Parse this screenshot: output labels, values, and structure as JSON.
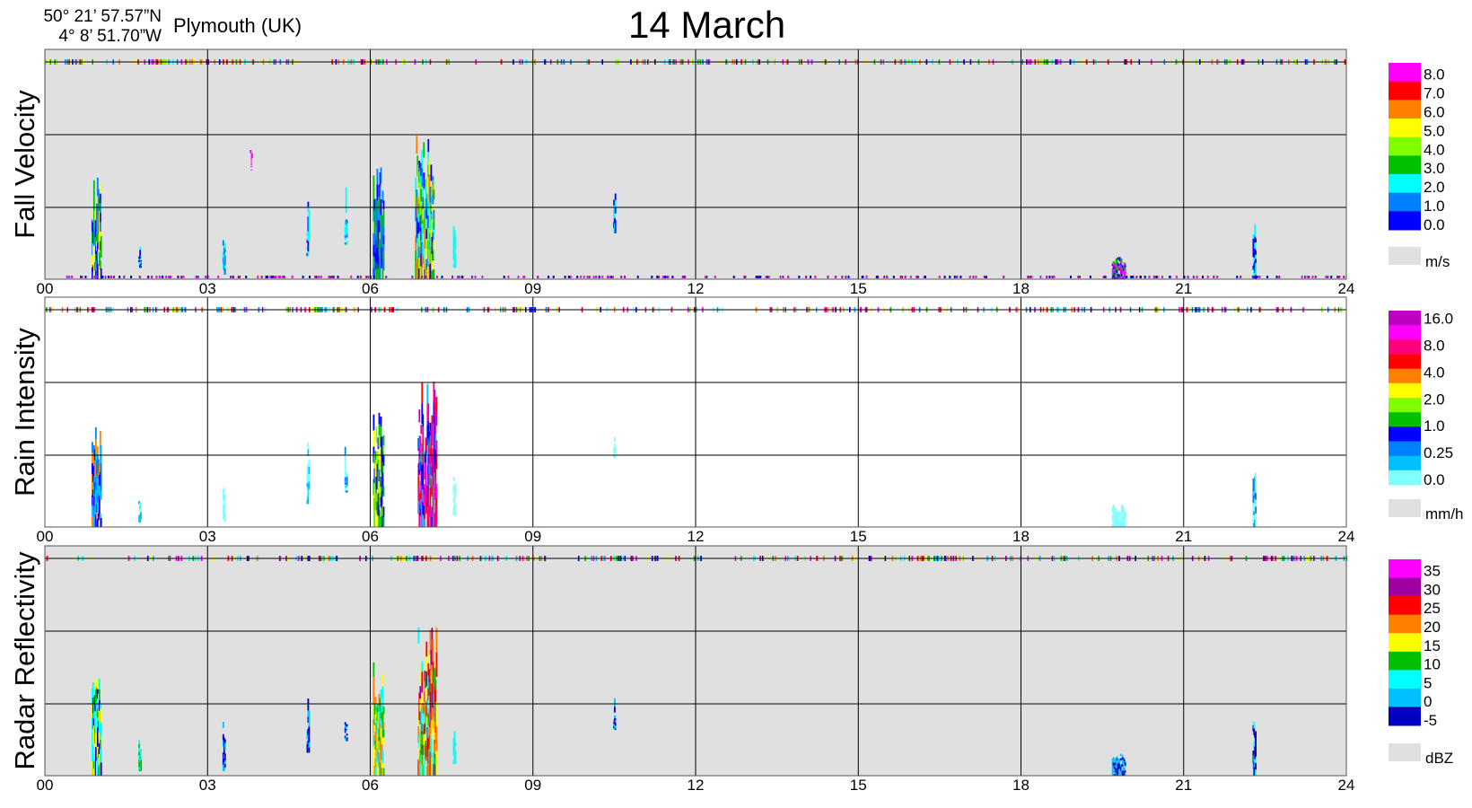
{
  "header": {
    "lat": "50° 21’ 57.57”N",
    "lon": "4°  8’ 51.70”W",
    "location": "Plymouth (UK)",
    "title": "14 March"
  },
  "colors": {
    "panel_bg": "#e0e0e0",
    "grid": "#000000"
  },
  "chart_data": [
    {
      "type": "heatmap",
      "ylabel": "Fall Velocity",
      "xlim": [
        0,
        24
      ],
      "x_ticks": [
        "00",
        "03",
        "06",
        "09",
        "12",
        "15",
        "18",
        "21",
        "24"
      ],
      "background": "#e0e0e0",
      "colorbar": {
        "unit": "m/s",
        "labels": [
          "8.0",
          "7.0",
          "6.0",
          "5.0",
          "4.0",
          "3.0",
          "2.0",
          "1.0",
          "0.0"
        ],
        "colors": [
          "#ff00ff",
          "#ff0000",
          "#ff8000",
          "#ffff00",
          "#80ff00",
          "#00c000",
          "#00ffff",
          "#0080ff",
          "#0000ff"
        ]
      },
      "events": [
        {
          "t": 0.95,
          "w": 0.18,
          "bottom": 0.0,
          "top": 0.45,
          "colors": [
            "#0000ff",
            "#0080ff",
            "#00c000",
            "#ffff00"
          ]
        },
        {
          "t": 1.75,
          "w": 0.05,
          "bottom": 0.05,
          "top": 0.16,
          "colors": [
            "#0000ff",
            "#00ffff"
          ]
        },
        {
          "t": 3.3,
          "w": 0.05,
          "bottom": 0.02,
          "top": 0.25,
          "colors": [
            "#0080ff",
            "#00ffff"
          ]
        },
        {
          "t": 3.8,
          "w": 0.04,
          "bottom": 0.55,
          "top": 0.6,
          "colors": [
            "#ff00ff"
          ]
        },
        {
          "t": 4.85,
          "w": 0.05,
          "bottom": 0.1,
          "top": 0.37,
          "colors": [
            "#0000ff",
            "#00ffff"
          ]
        },
        {
          "t": 5.55,
          "w": 0.05,
          "bottom": 0.15,
          "top": 0.4,
          "colors": [
            "#0080ff",
            "#00ffff"
          ]
        },
        {
          "t": 6.15,
          "w": 0.2,
          "bottom": 0.0,
          "top": 0.5,
          "colors": [
            "#0000ff",
            "#0080ff",
            "#00c000"
          ]
        },
        {
          "t": 7.0,
          "w": 0.35,
          "bottom": 0.0,
          "top": 0.65,
          "colors": [
            "#0000ff",
            "#0080ff",
            "#00ffff",
            "#00c000",
            "#80ff00",
            "#ffff00",
            "#ff8000"
          ]
        },
        {
          "t": 7.55,
          "w": 0.05,
          "bottom": 0.05,
          "top": 0.25,
          "colors": [
            "#00ffff"
          ]
        },
        {
          "t": 10.5,
          "w": 0.04,
          "bottom": 0.2,
          "top": 0.4,
          "colors": [
            "#0000ff",
            "#00ffff"
          ]
        },
        {
          "t": 19.8,
          "w": 0.25,
          "bottom": 0.0,
          "top": 0.1,
          "colors": [
            "#0000ff",
            "#00c000",
            "#ff00ff"
          ]
        },
        {
          "t": 22.3,
          "w": 0.06,
          "bottom": 0.0,
          "top": 0.28,
          "colors": [
            "#0000ff",
            "#00ffff"
          ]
        }
      ]
    },
    {
      "type": "heatmap",
      "ylabel": "Rain Intensity",
      "xlim": [
        0,
        24
      ],
      "x_ticks": [
        "00",
        "03",
        "06",
        "09",
        "12",
        "15",
        "18",
        "21",
        "24"
      ],
      "background": "#ffffff",
      "colorbar": {
        "unit": "mm/h",
        "labels": [
          "16.0",
          "8.0",
          "4.0",
          "2.0",
          "1.0",
          "0.25",
          "0.0"
        ],
        "colors": [
          "#c000c0",
          "#ff00ff",
          "#ff0080",
          "#ff0000",
          "#ff8000",
          "#ffff00",
          "#80ff00",
          "#00c000",
          "#0000ff",
          "#0080ff",
          "#00c0ff",
          "#80ffff"
        ]
      },
      "events": [
        {
          "t": 0.95,
          "w": 0.18,
          "bottom": 0.0,
          "top": 0.45,
          "colors": [
            "#0000ff",
            "#0080ff",
            "#00c0ff",
            "#ff8000"
          ]
        },
        {
          "t": 1.75,
          "w": 0.05,
          "bottom": 0.02,
          "top": 0.16,
          "colors": [
            "#00c0ff",
            "#80ffff"
          ]
        },
        {
          "t": 3.3,
          "w": 0.05,
          "bottom": 0.02,
          "top": 0.25,
          "colors": [
            "#80ffff"
          ]
        },
        {
          "t": 4.85,
          "w": 0.05,
          "bottom": 0.1,
          "top": 0.37,
          "colors": [
            "#00c0ff",
            "#80ffff"
          ]
        },
        {
          "t": 5.55,
          "w": 0.05,
          "bottom": 0.15,
          "top": 0.4,
          "colors": [
            "#0080ff",
            "#80ffff"
          ]
        },
        {
          "t": 6.15,
          "w": 0.2,
          "bottom": 0.0,
          "top": 0.5,
          "colors": [
            "#0000ff",
            "#00c000",
            "#80ff00",
            "#ffff00"
          ]
        },
        {
          "t": 7.05,
          "w": 0.35,
          "bottom": 0.0,
          "top": 0.65,
          "colors": [
            "#ff0080",
            "#ff00ff",
            "#c000c0",
            "#ff0000",
            "#0000ff",
            "#00c0ff"
          ]
        },
        {
          "t": 7.55,
          "w": 0.05,
          "bottom": 0.05,
          "top": 0.25,
          "colors": [
            "#80ffff"
          ]
        },
        {
          "t": 10.5,
          "w": 0.04,
          "bottom": 0.3,
          "top": 0.4,
          "colors": [
            "#80ffff"
          ]
        },
        {
          "t": 19.8,
          "w": 0.25,
          "bottom": 0.0,
          "top": 0.1,
          "colors": [
            "#80ffff"
          ]
        },
        {
          "t": 22.3,
          "w": 0.06,
          "bottom": 0.0,
          "top": 0.28,
          "colors": [
            "#0080ff",
            "#80ffff"
          ]
        }
      ]
    },
    {
      "type": "heatmap",
      "ylabel": "Radar Reflectivity",
      "xlim": [
        0,
        24
      ],
      "x_ticks": [
        "00",
        "03",
        "06",
        "09",
        "12",
        "15",
        "18",
        "21",
        "24"
      ],
      "background": "#e0e0e0",
      "colorbar": {
        "unit": "dBZ",
        "labels": [
          "35",
          "30",
          "25",
          "20",
          "15",
          "10",
          "5",
          "0",
          "-5"
        ],
        "colors": [
          "#ff00ff",
          "#a000a0",
          "#ff0000",
          "#ff8000",
          "#ffff00",
          "#00c000",
          "#00ffff",
          "#00c0ff",
          "#0000c0"
        ]
      },
      "events": [
        {
          "t": 0.95,
          "w": 0.18,
          "bottom": 0.0,
          "top": 0.45,
          "colors": [
            "#00c000",
            "#ffff00",
            "#00ffff",
            "#0000c0"
          ]
        },
        {
          "t": 1.75,
          "w": 0.05,
          "bottom": 0.02,
          "top": 0.16,
          "colors": [
            "#00ffff",
            "#00c000"
          ]
        },
        {
          "t": 3.3,
          "w": 0.05,
          "bottom": 0.02,
          "top": 0.25,
          "colors": [
            "#00c0ff",
            "#0000c0"
          ]
        },
        {
          "t": 4.85,
          "w": 0.05,
          "bottom": 0.1,
          "top": 0.37,
          "colors": [
            "#0000c0",
            "#00c0ff"
          ]
        },
        {
          "t": 5.55,
          "w": 0.05,
          "bottom": 0.15,
          "top": 0.4,
          "colors": [
            "#0000c0",
            "#00ffff"
          ]
        },
        {
          "t": 6.15,
          "w": 0.2,
          "bottom": 0.0,
          "top": 0.5,
          "colors": [
            "#ffff00",
            "#00c000",
            "#ff8000",
            "#00ffff"
          ]
        },
        {
          "t": 7.05,
          "w": 0.35,
          "bottom": 0.0,
          "top": 0.65,
          "colors": [
            "#ff8000",
            "#ffff00",
            "#ff0000",
            "#00c000",
            "#00ffff",
            "#a000a0"
          ]
        },
        {
          "t": 7.55,
          "w": 0.05,
          "bottom": 0.05,
          "top": 0.25,
          "colors": [
            "#00ffff"
          ]
        },
        {
          "t": 10.5,
          "w": 0.04,
          "bottom": 0.2,
          "top": 0.4,
          "colors": [
            "#00c0ff",
            "#0000c0"
          ]
        },
        {
          "t": 19.8,
          "w": 0.25,
          "bottom": 0.0,
          "top": 0.1,
          "colors": [
            "#0000c0",
            "#00c0ff"
          ]
        },
        {
          "t": 22.3,
          "w": 0.06,
          "bottom": 0.0,
          "top": 0.28,
          "colors": [
            "#0000c0",
            "#00ffff"
          ]
        }
      ]
    }
  ]
}
